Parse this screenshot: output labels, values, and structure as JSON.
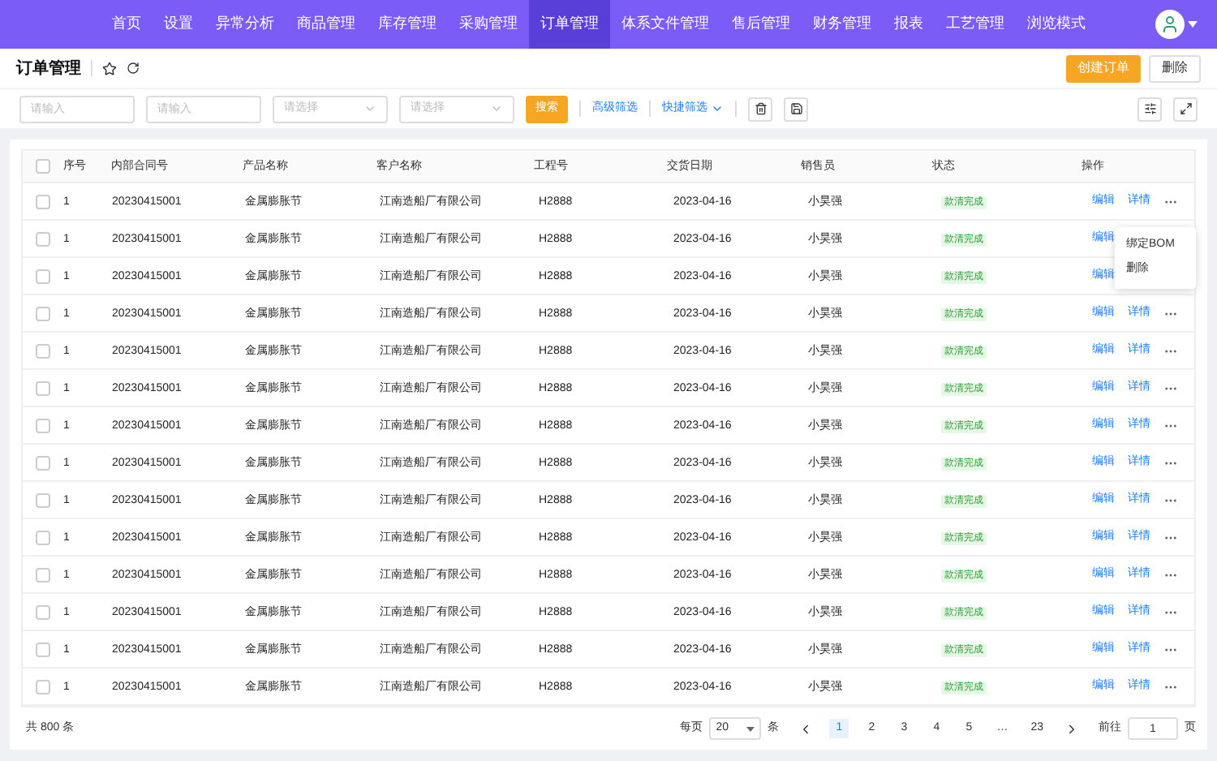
{
  "nav": [
    {
      "label": "首页",
      "selected": false
    },
    {
      "label": "设置",
      "selected": false
    },
    {
      "label": "异常分析",
      "selected": false
    },
    {
      "label": "商品管理",
      "selected": false
    },
    {
      "label": "库存管理",
      "selected": false
    },
    {
      "label": "采购管理",
      "selected": false
    },
    {
      "label": "订单管理",
      "selected": true
    },
    {
      "label": "体系文件管理",
      "selected": false
    },
    {
      "label": "售后管理",
      "selected": false
    },
    {
      "label": "财务管理",
      "selected": false
    },
    {
      "label": "报表",
      "selected": false
    },
    {
      "label": "工艺管理",
      "selected": false
    },
    {
      "label": "浏览模式",
      "selected": false
    }
  ],
  "page_title": "订单管理",
  "header_buttons": [
    {
      "label": "创建订单",
      "kind": "primary"
    },
    {
      "label": "删除",
      "kind": "default"
    }
  ],
  "filters": [
    {
      "kind": "input",
      "placeholder": "请输入"
    },
    {
      "kind": "input",
      "placeholder": "请输入"
    },
    {
      "kind": "select",
      "placeholder": "请选择"
    },
    {
      "kind": "select",
      "placeholder": "请选择"
    }
  ],
  "search_button": "搜索",
  "advanced_filter": "高级筛选",
  "quick_filter": "快捷筛选",
  "table": {
    "select_all_checked": false,
    "columns": [
      "序号",
      "内部合同号",
      "产品名称",
      "客户名称",
      "工程号",
      "交货日期",
      "销售员",
      "状态",
      "操作"
    ],
    "rows": [
      {
        "checked": false,
        "cells": [
          "1",
          "20230415001",
          "金属膨胀节",
          "江南造船厂有限公司",
          "H2888",
          "2023-04-16",
          "小昊强"
        ],
        "status": "款清完成",
        "actions": [
          "编辑",
          "详情"
        ],
        "more": true
      },
      {
        "checked": false,
        "cells": [
          "1",
          "20230415001",
          "金属膨胀节",
          "江南造船厂有限公司",
          "H2888",
          "2023-04-16",
          "小昊强"
        ],
        "status": "款清完成",
        "actions": [
          "编辑"
        ],
        "more": false
      },
      {
        "checked": false,
        "cells": [
          "1",
          "20230415001",
          "金属膨胀节",
          "江南造船厂有限公司",
          "H2888",
          "2023-04-16",
          "小昊强"
        ],
        "status": "款清完成",
        "actions": [
          "编辑"
        ],
        "more": false
      },
      {
        "checked": false,
        "cells": [
          "1",
          "20230415001",
          "金属膨胀节",
          "江南造船厂有限公司",
          "H2888",
          "2023-04-16",
          "小昊强"
        ],
        "status": "款清完成",
        "actions": [
          "编辑",
          "详情"
        ],
        "more": true
      },
      {
        "checked": false,
        "cells": [
          "1",
          "20230415001",
          "金属膨胀节",
          "江南造船厂有限公司",
          "H2888",
          "2023-04-16",
          "小昊强"
        ],
        "status": "款清完成",
        "actions": [
          "编辑",
          "详情"
        ],
        "more": true
      },
      {
        "checked": false,
        "cells": [
          "1",
          "20230415001",
          "金属膨胀节",
          "江南造船厂有限公司",
          "H2888",
          "2023-04-16",
          "小昊强"
        ],
        "status": "款清完成",
        "actions": [
          "编辑",
          "详情"
        ],
        "more": true
      },
      {
        "checked": false,
        "cells": [
          "1",
          "20230415001",
          "金属膨胀节",
          "江南造船厂有限公司",
          "H2888",
          "2023-04-16",
          "小昊强"
        ],
        "status": "款清完成",
        "actions": [
          "编辑",
          "详情"
        ],
        "more": true
      },
      {
        "checked": false,
        "cells": [
          "1",
          "20230415001",
          "金属膨胀节",
          "江南造船厂有限公司",
          "H2888",
          "2023-04-16",
          "小昊强"
        ],
        "status": "款清完成",
        "actions": [
          "编辑",
          "详情"
        ],
        "more": true
      },
      {
        "checked": false,
        "cells": [
          "1",
          "20230415001",
          "金属膨胀节",
          "江南造船厂有限公司",
          "H2888",
          "2023-04-16",
          "小昊强"
        ],
        "status": "款清完成",
        "actions": [
          "编辑",
          "详情"
        ],
        "more": true
      },
      {
        "checked": false,
        "cells": [
          "1",
          "20230415001",
          "金属膨胀节",
          "江南造船厂有限公司",
          "H2888",
          "2023-04-16",
          "小昊强"
        ],
        "status": "款清完成",
        "actions": [
          "编辑",
          "详情"
        ],
        "more": true
      },
      {
        "checked": false,
        "cells": [
          "1",
          "20230415001",
          "金属膨胀节",
          "江南造船厂有限公司",
          "H2888",
          "2023-04-16",
          "小昊强"
        ],
        "status": "款清完成",
        "actions": [
          "编辑",
          "详情"
        ],
        "more": true
      },
      {
        "checked": false,
        "cells": [
          "1",
          "20230415001",
          "金属膨胀节",
          "江南造船厂有限公司",
          "H2888",
          "2023-04-16",
          "小昊强"
        ],
        "status": "款清完成",
        "actions": [
          "编辑",
          "详情"
        ],
        "more": true
      },
      {
        "checked": false,
        "cells": [
          "1",
          "20230415001",
          "金属膨胀节",
          "江南造船厂有限公司",
          "H2888",
          "2023-04-16",
          "小昊强"
        ],
        "status": "款清完成",
        "actions": [
          "编辑",
          "详情"
        ],
        "more": true
      },
      {
        "checked": false,
        "cells": [
          "1",
          "20230415001",
          "金属膨胀节",
          "江南造船厂有限公司",
          "H2888",
          "2023-04-16",
          "小昊强"
        ],
        "status": "款清完成",
        "actions": [
          "编辑",
          "详情"
        ],
        "more": true
      }
    ]
  },
  "more_menu": [
    "绑定BOM",
    "删除"
  ],
  "pagination": {
    "total": "共 800 条",
    "per_page_label": "每页",
    "per_page": "20",
    "unit": "条",
    "pages": [
      {
        "label": "1",
        "selected": true
      },
      {
        "label": "2",
        "selected": false
      },
      {
        "label": "3",
        "selected": false
      },
      {
        "label": "4",
        "selected": false
      },
      {
        "label": "5",
        "selected": false
      },
      {
        "label": "…",
        "selected": false
      },
      {
        "label": "23",
        "selected": false
      }
    ],
    "goto_label": "前往",
    "goto_value": "1",
    "goto_unit": "页"
  }
}
